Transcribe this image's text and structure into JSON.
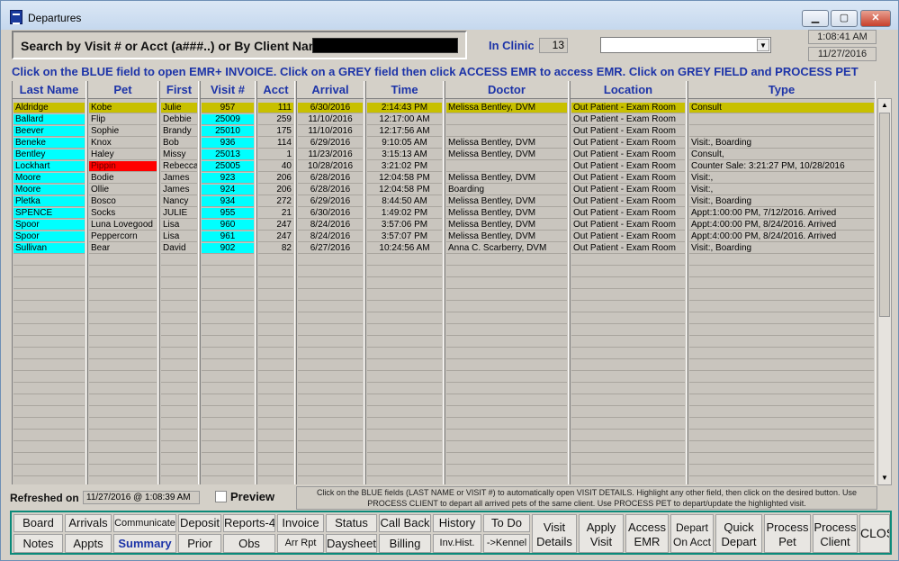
{
  "window": {
    "title": "Departures",
    "min_glyph": "▁",
    "max_glyph": "▢",
    "close_glyph": "✕"
  },
  "search": {
    "label": "Search by Visit # or Acct (a###..) or By Client Name",
    "value": ""
  },
  "in_clinic": {
    "label": "In Clinic",
    "count": "13"
  },
  "filter": {
    "selected": "",
    "arrow": "▼"
  },
  "clock": {
    "time": "1:08:41 AM",
    "date": "11/27/2016"
  },
  "instructions": "Click on the BLUE field to open EMR+ INVOICE.  Click on a GREY field then click ACCESS EMR to access EMR.  Click on GREY FIELD and PROCESS PET",
  "columns": [
    "Last Name",
    "Pet",
    "First",
    "Visit #",
    "Acct",
    "Arrival",
    "Time",
    "Doctor",
    "Location",
    "Type"
  ],
  "rows": [
    {
      "last": "Aldridge",
      "pet": "Kobe",
      "first": "Julie",
      "visit": "957",
      "acct": "111",
      "arrival": "6/30/2016",
      "time": "2:14:43 PM",
      "doctor": "Melissa Bentley, DVM",
      "location": "Out Patient - Exam Room",
      "type": "Consult",
      "selected": true
    },
    {
      "last": "Ballard",
      "pet": "Flip",
      "first": "Debbie",
      "visit": "25009",
      "acct": "259",
      "arrival": "11/10/2016",
      "time": "12:17:00 AM",
      "doctor": "",
      "location": "Out Patient - Exam Room",
      "type": ""
    },
    {
      "last": "Beever",
      "pet": "Sophie",
      "first": "Brandy",
      "visit": "25010",
      "acct": "175",
      "arrival": "11/10/2016",
      "time": "12:17:56 AM",
      "doctor": "",
      "location": "Out Patient - Exam Room",
      "type": ""
    },
    {
      "last": "Beneke",
      "pet": "Knox",
      "first": "Bob",
      "visit": "936",
      "acct": "114",
      "arrival": "6/29/2016",
      "time": "9:10:05 AM",
      "doctor": "Melissa Bentley, DVM",
      "location": "Out Patient - Exam Room",
      "type": "Visit:, Boarding"
    },
    {
      "last": "Bentley",
      "pet": "Haley",
      "first": "Missy",
      "visit": "25013",
      "acct": "1",
      "arrival": "11/23/2016",
      "time": "3:15:13 AM",
      "doctor": "Melissa Bentley, DVM",
      "location": "Out Patient - Exam Room",
      "type": "Consult,"
    },
    {
      "last": "Lockhart",
      "pet": "Pippin",
      "first": "Rebecca",
      "visit": "25005",
      "acct": "40",
      "arrival": "10/28/2016",
      "time": "3:21:02 PM",
      "doctor": "",
      "location": "Out Patient - Exam Room",
      "type": "Counter Sale: 3:21:27 PM, 10/28/2016",
      "pet_alert": true
    },
    {
      "last": "Moore",
      "pet": "Bodie",
      "first": "James",
      "visit": "923",
      "acct": "206",
      "arrival": "6/28/2016",
      "time": "12:04:58 PM",
      "doctor": "Melissa Bentley, DVM",
      "location": "Out Patient - Exam Room",
      "type": "Visit:,"
    },
    {
      "last": "Moore",
      "pet": "Ollie",
      "first": "James",
      "visit": "924",
      "acct": "206",
      "arrival": "6/28/2016",
      "time": "12:04:58 PM",
      "doctor": "Boarding",
      "location": "Out Patient - Exam Room",
      "type": "Visit:,"
    },
    {
      "last": "Pletka",
      "pet": "Bosco",
      "first": "Nancy",
      "visit": "934",
      "acct": "272",
      "arrival": "6/29/2016",
      "time": "8:44:50 AM",
      "doctor": "Melissa Bentley, DVM",
      "location": "Out Patient - Exam Room",
      "type": "Visit:, Boarding"
    },
    {
      "last": "SPENCE",
      "pet": "Socks",
      "first": "JULIE",
      "visit": "955",
      "acct": "21",
      "arrival": "6/30/2016",
      "time": "1:49:02 PM",
      "doctor": "Melissa Bentley, DVM",
      "location": "Out Patient - Exam Room",
      "type": "Appt:1:00:00 PM, 7/12/2016. Arrived"
    },
    {
      "last": "Spoor",
      "pet": "Luna Lovegood",
      "first": "Lisa",
      "visit": "960",
      "acct": "247",
      "arrival": "8/24/2016",
      "time": "3:57:06 PM",
      "doctor": "Melissa Bentley, DVM",
      "location": "Out Patient - Exam Room",
      "type": "Appt:4:00:00 PM, 8/24/2016. Arrived"
    },
    {
      "last": "Spoor",
      "pet": "Peppercorn",
      "first": "Lisa",
      "visit": "961",
      "acct": "247",
      "arrival": "8/24/2016",
      "time": "3:57:07 PM",
      "doctor": "Melissa Bentley, DVM",
      "location": "Out Patient - Exam Room",
      "type": "Appt:4:00:00 PM, 8/24/2016. Arrived"
    },
    {
      "last": "Sullivan",
      "pet": "Bear",
      "first": "David",
      "visit": "902",
      "acct": "82",
      "arrival": "6/27/2016",
      "time": "10:24:56 AM",
      "doctor": "Anna C. Scarberry, DVM",
      "location": "Out Patient - Exam Room",
      "type": "Visit:, Boarding"
    }
  ],
  "scroll": {
    "up": "▲",
    "down": "▼"
  },
  "refreshed": {
    "label": "Refreshed on",
    "value": "11/27/2016 @ 1:08:39 AM"
  },
  "preview": {
    "label": "Preview",
    "checked": false
  },
  "help_text": "Click on the BLUE fields (LAST NAME or VISIT #) to automatically open VISIT DETAILS.  Highlight any other field, then click on the desired button.  Use PROCESS CLIENT to depart all arrived pets of the same client.  Use PROCESS PET to depart/update the highlighted visit.",
  "toolbar": {
    "board": "Board",
    "arrivals": "Arrivals",
    "communicate": "Communicate",
    "deposit": "Deposit",
    "reports4": "Reports-4",
    "invoice": "Invoice",
    "status": "Status",
    "callback": "Call Back",
    "history": "History",
    "todo": "To Do",
    "notes": "Notes",
    "appts": "Appts",
    "summary": "Summary",
    "prior": "Prior",
    "obs": "Obs",
    "arrrpt": "Arr Rpt",
    "daysheet": "Daysheet",
    "billing": "Billing",
    "invhist": "Inv.Hist.",
    "kennel": "->Kennel",
    "visit_details_1": "Visit",
    "visit_details_2": "Details",
    "apply_visit_1": "Apply",
    "apply_visit_2": "Visit",
    "access_emr_1": "Access",
    "access_emr_2": "EMR",
    "depart_acct_1": "Depart",
    "depart_acct_2": "On Acct",
    "quick_depart_1": "Quick",
    "quick_depart_2": "Depart",
    "process_pet_1": "Process",
    "process_pet_2": "Pet",
    "process_client_1": "Process",
    "process_client_2": "Client",
    "close": "CLOSE"
  },
  "colors": {
    "cyan": "#00ffff",
    "selected": "#c8c000",
    "alert": "#ff0000",
    "header_text": "#1d34a8",
    "toolbar_border": "#0b8a7a"
  }
}
